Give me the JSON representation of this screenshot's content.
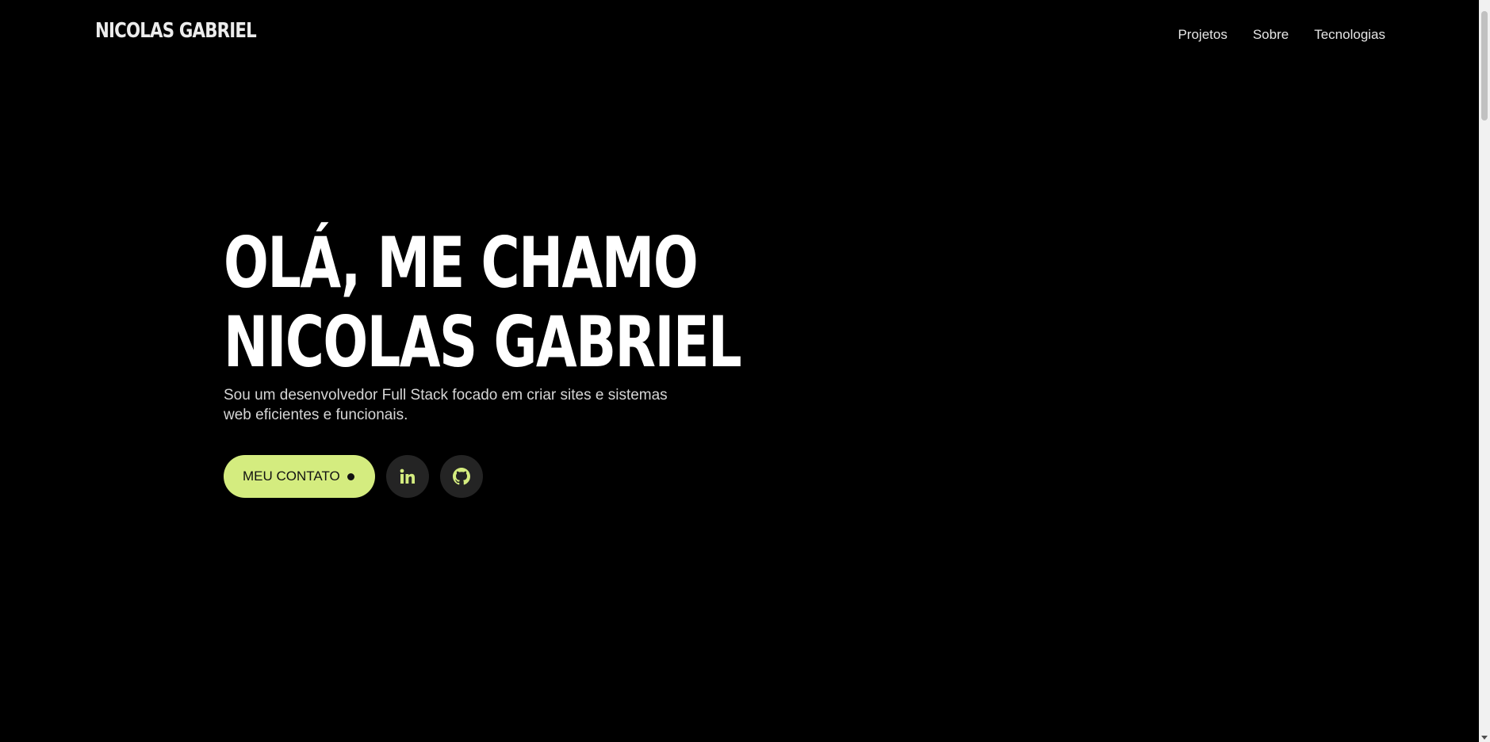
{
  "header": {
    "logo": "NICOLAS GABRIEL",
    "nav": [
      "Projetos",
      "Sobre",
      "Tecnologias"
    ]
  },
  "hero": {
    "title_line1": "OLÁ, ME CHAMO",
    "title_line2": "NICOLAS GABRIEL",
    "description": "Sou um desenvolvedor Full Stack focado em criar sites e sistemas web eficientes e funcionais.",
    "contact_button": "MEU CONTATO",
    "social_icons": [
      "linkedin-icon",
      "github-icon"
    ]
  },
  "colors": {
    "background": "#000000",
    "accent": "#d4ec7f",
    "icon_button_bg": "#242424"
  }
}
